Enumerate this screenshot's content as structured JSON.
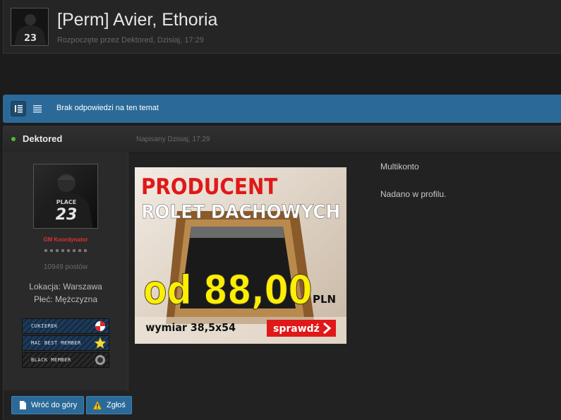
{
  "topic": {
    "title": "[Perm] Avier, Ethoria",
    "meta": "Rozpoczęte przez Dektored, Dzisiaj, 17:29"
  },
  "bar": {
    "reply_text": "Brak odpowiedzi na ten temat",
    "mode_icons": [
      "list-view-icon",
      "text-view-icon"
    ]
  },
  "post": {
    "author": "Dektored",
    "date": "Napisany Dzisiaj, 17:29",
    "rank": "GM Koordynator",
    "pips": 8,
    "post_count": "10949 postów",
    "location": "Lokacja: Warszawa",
    "gender": "Płeć: Mężczyzna",
    "awards": [
      "CUKIEREK",
      "MAC BEST MEMBER",
      "BLACK MEMBER"
    ],
    "body": [
      "Multikonto",
      "Nadano w profilu."
    ],
    "avatar_text": [
      "PLACE",
      "23"
    ]
  },
  "ad": {
    "line1": "PRODUCENT",
    "line2": "ROLET DACHOWYCH",
    "price": "od 88,00",
    "currency": "PLN",
    "size": "wymiar 38,5x54",
    "cta": "sprawdź"
  },
  "footer": {
    "back_top": "Wróć do góry",
    "report": "Zgłoś"
  },
  "colors": {
    "accent": "#2b6a98",
    "rank": "#e03030",
    "online": "#55b932",
    "ad_red": "#e01818",
    "ad_yellow": "#ffee00"
  }
}
